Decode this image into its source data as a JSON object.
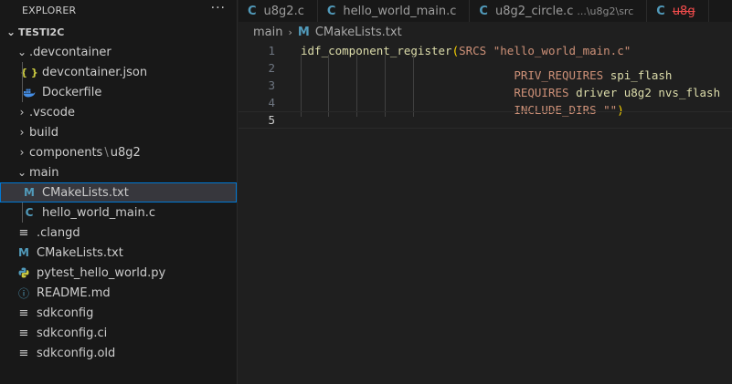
{
  "explorer": {
    "title": "EXPLORER",
    "more": "···",
    "root": "TESTI2C",
    "items": [
      {
        "label": ".devcontainer",
        "kind": "folder-open"
      },
      {
        "label": "devcontainer.json",
        "kind": "json"
      },
      {
        "label": "Dockerfile",
        "kind": "docker"
      },
      {
        "label": ".vscode",
        "kind": "folder"
      },
      {
        "label": "build",
        "kind": "folder"
      },
      {
        "label": "components",
        "sep": "\\",
        "label2": "u8g2",
        "kind": "folder"
      },
      {
        "label": "main",
        "kind": "folder-open"
      },
      {
        "label": "CMakeLists.txt",
        "kind": "cmake"
      },
      {
        "label": "hello_world_main.c",
        "kind": "c"
      },
      {
        "label": ".clangd",
        "kind": "lines"
      },
      {
        "label": "CMakeLists.txt",
        "kind": "cmake"
      },
      {
        "label": "pytest_hello_world.py",
        "kind": "python"
      },
      {
        "label": "README.md",
        "kind": "info"
      },
      {
        "label": "sdkconfig",
        "kind": "lines"
      },
      {
        "label": "sdkconfig.ci",
        "kind": "lines"
      },
      {
        "label": "sdkconfig.old",
        "kind": "lines"
      }
    ]
  },
  "tabs": [
    {
      "label": "u8g2.c",
      "icon": "C"
    },
    {
      "label": "hello_world_main.c",
      "icon": "C"
    },
    {
      "label": "u8g2_circle.c",
      "desc": "...\\u8g2\\src",
      "icon": "C"
    },
    {
      "label": "u8g",
      "icon": "C"
    }
  ],
  "breadcrumb": {
    "folder": "main",
    "file": "CMakeLists.txt"
  },
  "editor": {
    "lines": [
      {
        "num": "1",
        "fn": "idf_component_register",
        "open": "(",
        "kw": "SRCS",
        "str": "\"hello_world_main.c\""
      },
      {
        "num": "2",
        "kw": "PRIV_REQUIRES",
        "args": "spi_flash"
      },
      {
        "num": "3",
        "kw": "REQUIRES",
        "args": "driver u8g2 nvs_flash"
      },
      {
        "num": "4",
        "kw": "INCLUDE_DIRS",
        "str": "\"\"",
        "close": ")"
      },
      {
        "num": "5"
      }
    ]
  },
  "icons": {
    "c": "C",
    "cmake": "M",
    "json": "{ }",
    "lines": "≡",
    "info": "ⓘ",
    "chev_down": "⌄",
    "chev_right": "›"
  },
  "colors": {
    "accent": "#0078d4",
    "c_icon": "#519aba",
    "json_icon": "#cbcb41",
    "error": "#f14c4c"
  }
}
